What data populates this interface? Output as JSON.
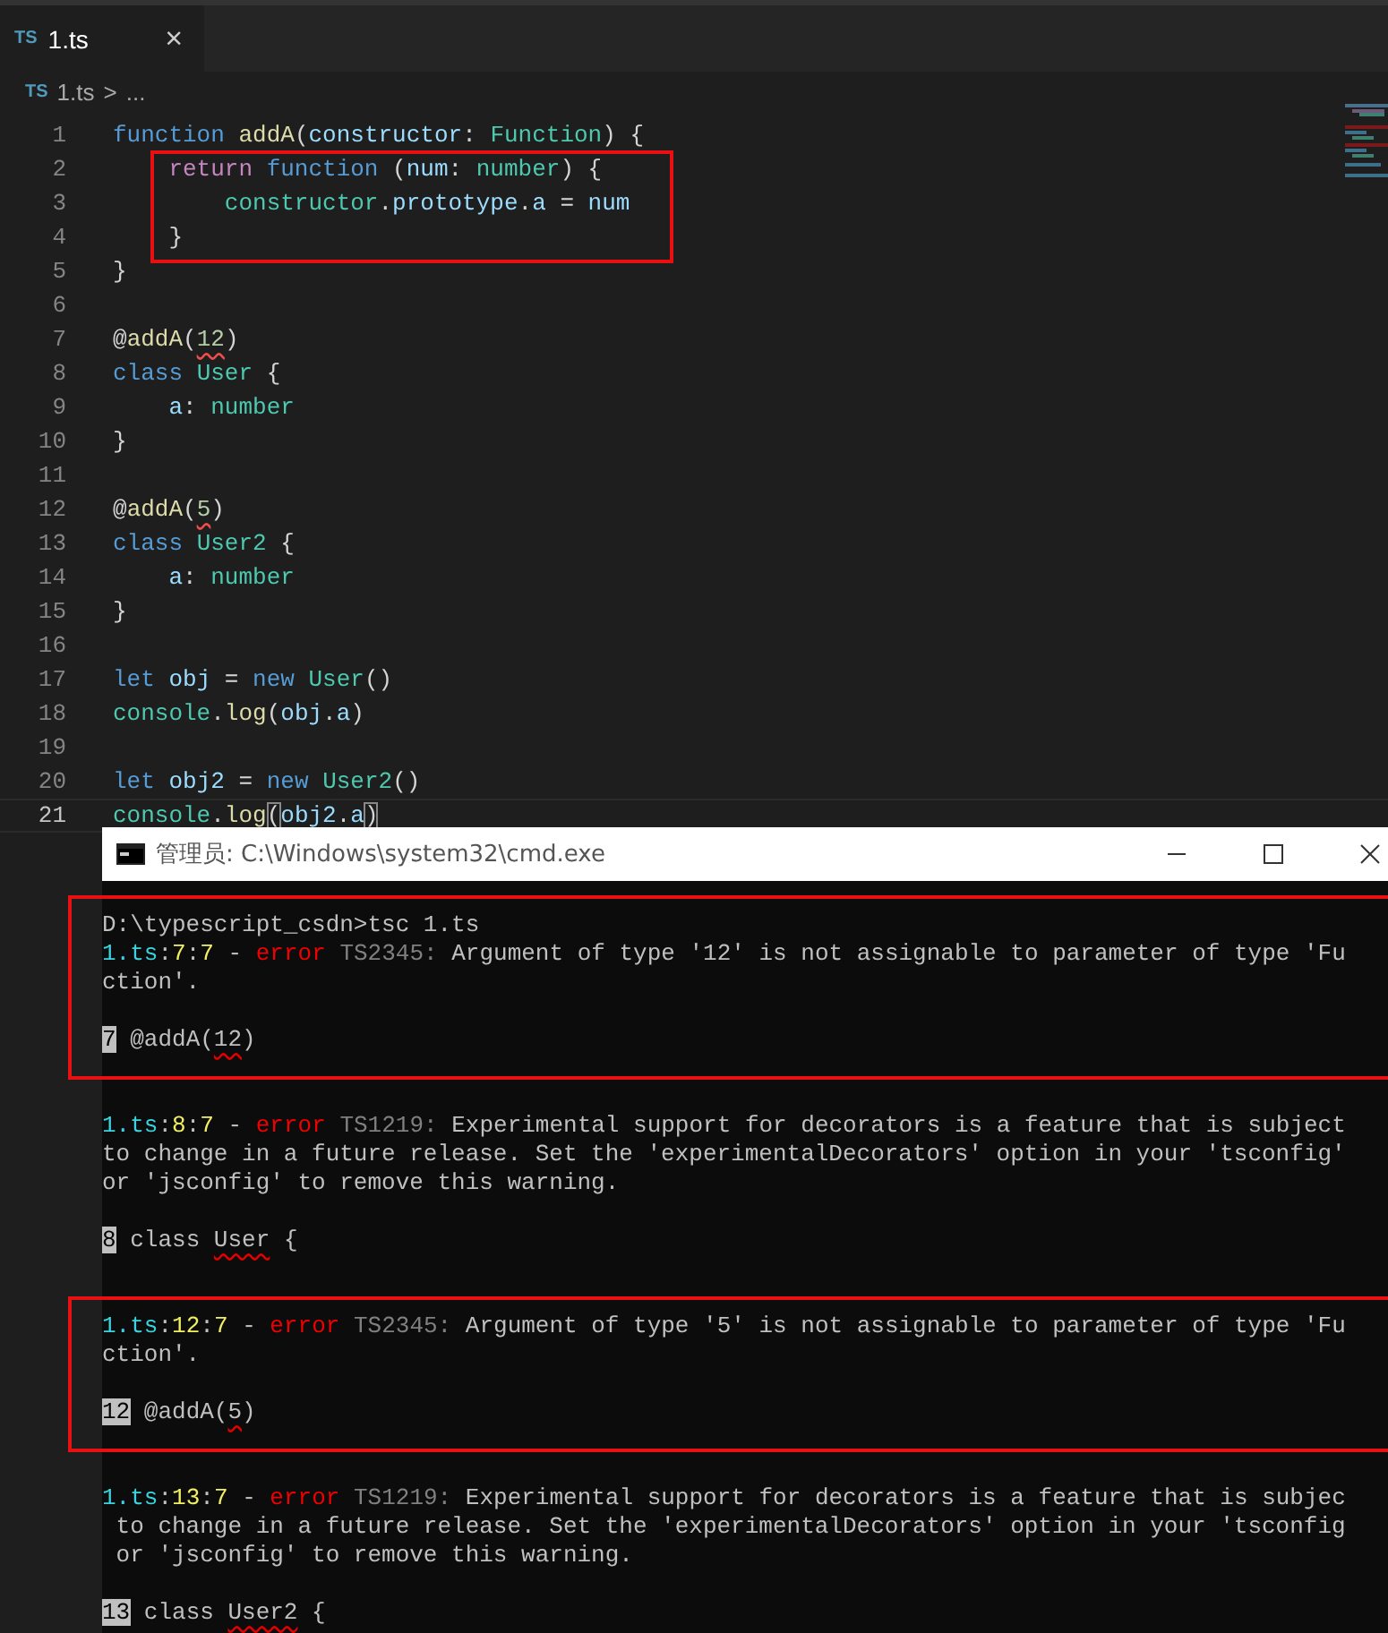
{
  "editor": {
    "tab": {
      "icon_label": "TS",
      "title": "1.ts",
      "close": "×",
      "selected": true
    },
    "breadcrumb": {
      "icon_label": "TS",
      "file": "1.ts",
      "separator": ">",
      "rest": "..."
    },
    "lines": [
      {
        "number": "1",
        "boxed": false,
        "current": false,
        "tokens": [
          {
            "text": "function ",
            "kind": "keyword"
          },
          {
            "text": "addA",
            "kind": "func"
          },
          {
            "text": "(",
            "kind": "plain"
          },
          {
            "text": "constructor",
            "kind": "var"
          },
          {
            "text": ": ",
            "kind": "plain"
          },
          {
            "text": "Function",
            "kind": "type"
          },
          {
            "text": ") {",
            "kind": "plain"
          }
        ]
      },
      {
        "number": "2",
        "boxed": true,
        "tokens": [
          {
            "text": "    return ",
            "kind": "control"
          },
          {
            "text": "function ",
            "kind": "keyword"
          },
          {
            "text": "(",
            "kind": "plain"
          },
          {
            "text": "num",
            "kind": "var"
          },
          {
            "text": ": ",
            "kind": "plain"
          },
          {
            "text": "number",
            "kind": "type"
          },
          {
            "text": ") {",
            "kind": "plain"
          }
        ]
      },
      {
        "number": "3",
        "boxed": true,
        "tokens": [
          {
            "text": "        constructor",
            "kind": "type"
          },
          {
            "text": ".",
            "kind": "plain"
          },
          {
            "text": "prototype",
            "kind": "var"
          },
          {
            "text": ".",
            "kind": "plain"
          },
          {
            "text": "a",
            "kind": "var"
          },
          {
            "text": " = ",
            "kind": "plain"
          },
          {
            "text": "num",
            "kind": "var"
          }
        ]
      },
      {
        "number": "4",
        "boxed": true,
        "tokens": [
          {
            "text": "    }",
            "kind": "plain"
          }
        ]
      },
      {
        "number": "5",
        "boxed": false,
        "tokens": [
          {
            "text": "}",
            "kind": "plain"
          }
        ]
      },
      {
        "number": "6",
        "boxed": false
      },
      {
        "number": "7",
        "boxed": false,
        "tokens": [
          {
            "text": "@",
            "kind": "plain"
          },
          {
            "text": "addA",
            "kind": "func"
          },
          {
            "text": "(",
            "kind": "plain"
          },
          {
            "text": "12",
            "kind": "number",
            "squiggle": true
          },
          {
            "text": ")",
            "kind": "plain"
          }
        ]
      },
      {
        "number": "8",
        "boxed": false,
        "tokens": [
          {
            "text": "class ",
            "kind": "keyword"
          },
          {
            "text": "User",
            "kind": "type"
          },
          {
            "text": " {",
            "kind": "plain"
          }
        ]
      },
      {
        "number": "9",
        "boxed": false,
        "tokens": [
          {
            "text": "    a",
            "kind": "var"
          },
          {
            "text": ": ",
            "kind": "plain"
          },
          {
            "text": "number",
            "kind": "type"
          }
        ]
      },
      {
        "number": "10",
        "boxed": false,
        "tokens": [
          {
            "text": "}",
            "kind": "plain"
          }
        ]
      },
      {
        "number": "11",
        "boxed": false
      },
      {
        "number": "12",
        "boxed": false,
        "tokens": [
          {
            "text": "@",
            "kind": "plain"
          },
          {
            "text": "addA",
            "kind": "func"
          },
          {
            "text": "(",
            "kind": "plain"
          },
          {
            "text": "5",
            "kind": "number",
            "squiggle": true
          },
          {
            "text": ")",
            "kind": "plain"
          }
        ]
      },
      {
        "number": "13",
        "boxed": false,
        "tokens": [
          {
            "text": "class ",
            "kind": "keyword"
          },
          {
            "text": "User2",
            "kind": "type"
          },
          {
            "text": " {",
            "kind": "plain"
          }
        ]
      },
      {
        "number": "14",
        "boxed": false,
        "tokens": [
          {
            "text": "    a",
            "kind": "var"
          },
          {
            "text": ": ",
            "kind": "plain"
          },
          {
            "text": "number",
            "kind": "type"
          }
        ]
      },
      {
        "number": "15",
        "boxed": false,
        "tokens": [
          {
            "text": "}",
            "kind": "plain"
          }
        ]
      },
      {
        "number": "16",
        "boxed": false
      },
      {
        "number": "17",
        "boxed": false,
        "tokens": [
          {
            "text": "let ",
            "kind": "keyword"
          },
          {
            "text": "obj",
            "kind": "var"
          },
          {
            "text": " = ",
            "kind": "plain"
          },
          {
            "text": "new ",
            "kind": "keyword"
          },
          {
            "text": "User",
            "kind": "type"
          },
          {
            "text": "()",
            "kind": "plain"
          }
        ]
      },
      {
        "number": "18",
        "boxed": false,
        "tokens": [
          {
            "text": "console",
            "kind": "type"
          },
          {
            "text": ".",
            "kind": "plain"
          },
          {
            "text": "log",
            "kind": "func"
          },
          {
            "text": "(",
            "kind": "plain"
          },
          {
            "text": "obj",
            "kind": "var"
          },
          {
            "text": ".",
            "kind": "plain"
          },
          {
            "text": "a",
            "kind": "var"
          },
          {
            "text": ")",
            "kind": "plain"
          }
        ]
      },
      {
        "number": "19",
        "boxed": false
      },
      {
        "number": "20",
        "boxed": false,
        "tokens": [
          {
            "text": "let ",
            "kind": "keyword"
          },
          {
            "text": "obj2",
            "kind": "var"
          },
          {
            "text": " = ",
            "kind": "plain"
          },
          {
            "text": "new ",
            "kind": "keyword"
          },
          {
            "text": "User2",
            "kind": "type"
          },
          {
            "text": "()",
            "kind": "plain"
          }
        ]
      },
      {
        "number": "21",
        "boxed": false,
        "current": true,
        "tokens": [
          {
            "text": "console",
            "kind": "type"
          },
          {
            "text": ".",
            "kind": "plain"
          },
          {
            "text": "log",
            "kind": "func"
          },
          {
            "text": "(",
            "kind": "plain",
            "matched": true
          },
          {
            "text": "obj2",
            "kind": "var"
          },
          {
            "text": ".",
            "kind": "plain"
          },
          {
            "text": "a",
            "kind": "var"
          },
          {
            "text": ")",
            "kind": "plain",
            "matched": true
          }
        ]
      }
    ]
  },
  "terminal": {
    "title": "管理员: C:\\Windows\\system32\\cmd.exe",
    "messages": [
      {
        "boxed": true,
        "lines": [
          [
            {
              "text": "D:\\typescript_csdn>tsc 1.ts",
              "kind": "plain"
            }
          ],
          [
            {
              "text": "1.ts",
              "kind": "file"
            },
            {
              "text": ":",
              "kind": "plain"
            },
            {
              "text": "7",
              "kind": "pos"
            },
            {
              "text": ":",
              "kind": "plain"
            },
            {
              "text": "7",
              "kind": "pos"
            },
            {
              "text": " - ",
              "kind": "plain"
            },
            {
              "text": "error",
              "kind": "error"
            },
            {
              "text": " TS2345:",
              "kind": "code"
            },
            {
              "text": " Argument of type '12' is not assignable to parameter of type 'Fu",
              "kind": "plain"
            }
          ],
          [
            {
              "text": "ction'.",
              "kind": "plain"
            }
          ]
        ],
        "source": [
          {
            "text": "7",
            "kind": "gutter"
          },
          {
            "text": " @addA(",
            "kind": "plain"
          },
          {
            "text": "12",
            "kind": "plain",
            "squiggle": true
          },
          {
            "text": ")",
            "kind": "plain"
          }
        ]
      },
      {
        "boxed": false,
        "lines": [
          [
            {
              "text": "1.ts",
              "kind": "file"
            },
            {
              "text": ":",
              "kind": "plain"
            },
            {
              "text": "8",
              "kind": "pos"
            },
            {
              "text": ":",
              "kind": "plain"
            },
            {
              "text": "7",
              "kind": "pos"
            },
            {
              "text": " - ",
              "kind": "plain"
            },
            {
              "text": "error",
              "kind": "error"
            },
            {
              "text": " TS1219:",
              "kind": "code"
            },
            {
              "text": " Experimental support for decorators is a feature that is subject",
              "kind": "plain"
            }
          ],
          [
            {
              "text": "to change in a future release. Set the 'experimentalDecorators' option in your 'tsconfig'",
              "kind": "plain"
            }
          ],
          [
            {
              "text": "or 'jsconfig' to remove this warning.",
              "kind": "plain"
            }
          ]
        ],
        "source": [
          {
            "text": "8",
            "kind": "gutter"
          },
          {
            "text": " class ",
            "kind": "plain"
          },
          {
            "text": "User",
            "kind": "plain",
            "squiggle": true
          },
          {
            "text": " {",
            "kind": "plain"
          }
        ]
      },
      {
        "boxed": true,
        "lines": [
          [
            {
              "text": "1.ts",
              "kind": "file"
            },
            {
              "text": ":",
              "kind": "plain"
            },
            {
              "text": "12",
              "kind": "pos"
            },
            {
              "text": ":",
              "kind": "plain"
            },
            {
              "text": "7",
              "kind": "pos"
            },
            {
              "text": " - ",
              "kind": "plain"
            },
            {
              "text": "error",
              "kind": "error"
            },
            {
              "text": " TS2345:",
              "kind": "code"
            },
            {
              "text": " Argument of type '5' is not assignable to parameter of type 'Fu",
              "kind": "plain"
            }
          ],
          [
            {
              "text": "ction'.",
              "kind": "plain"
            }
          ]
        ],
        "source": [
          {
            "text": "12",
            "kind": "gutter"
          },
          {
            "text": " @addA(",
            "kind": "plain"
          },
          {
            "text": "5",
            "kind": "plain",
            "squiggle": true
          },
          {
            "text": ")",
            "kind": "plain"
          }
        ]
      },
      {
        "boxed": false,
        "lines": [
          [
            {
              "text": "1.ts",
              "kind": "file"
            },
            {
              "text": ":",
              "kind": "plain"
            },
            {
              "text": "13",
              "kind": "pos"
            },
            {
              "text": ":",
              "kind": "plain"
            },
            {
              "text": "7",
              "kind": "pos"
            },
            {
              "text": " - ",
              "kind": "plain"
            },
            {
              "text": "error",
              "kind": "error"
            },
            {
              "text": " TS1219:",
              "kind": "code"
            },
            {
              "text": " Experimental support for decorators is a feature that is subjec",
              "kind": "plain"
            }
          ],
          [
            {
              "text": " to change in a future release. Set the 'experimentalDecorators' option in your 'tsconfig",
              "kind": "plain"
            }
          ],
          [
            {
              "text": " or 'jsconfig' to remove this warning.",
              "kind": "plain"
            }
          ]
        ],
        "source": [
          {
            "text": "13",
            "kind": "gutter"
          },
          {
            "text": " class ",
            "kind": "plain"
          },
          {
            "text": "User2",
            "kind": "plain",
            "squiggle": true
          },
          {
            "text": " {",
            "kind": "plain"
          }
        ]
      }
    ]
  }
}
